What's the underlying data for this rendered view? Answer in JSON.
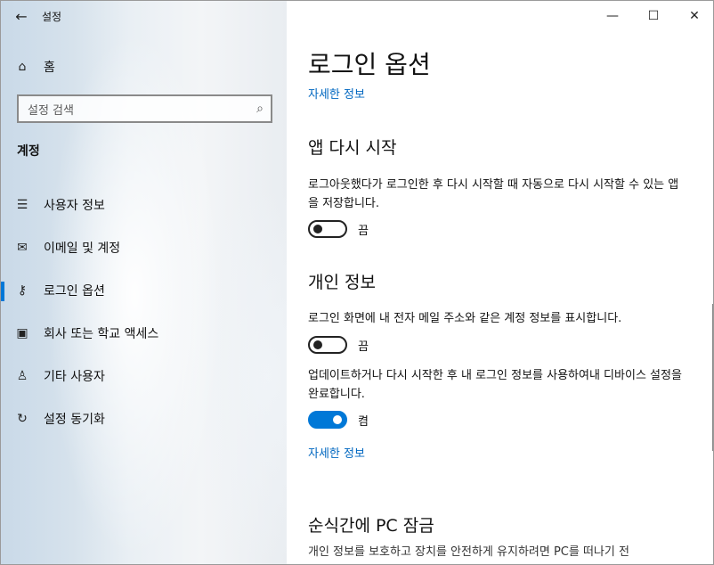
{
  "window": {
    "title": "설정",
    "back_glyph": "←",
    "controls": {
      "minimize": "—",
      "maximize": "☐",
      "close": "✕"
    }
  },
  "sidebar": {
    "home": {
      "icon": "⌂",
      "label": "홈"
    },
    "search": {
      "placeholder": "설정 검색",
      "icon": "⌕"
    },
    "section_title": "계정",
    "items": [
      {
        "icon": "☰",
        "label": "사용자 정보",
        "selected": false
      },
      {
        "icon": "✉",
        "label": "이메일 및 계정",
        "selected": false
      },
      {
        "icon": "⚷",
        "label": "로그인 옵션",
        "selected": true
      },
      {
        "icon": "▣",
        "label": "회사 또는 학교 액세스",
        "selected": false
      },
      {
        "icon": "♙",
        "label": "기타 사용자",
        "selected": false
      },
      {
        "icon": "↻",
        "label": "설정 동기화",
        "selected": false
      }
    ]
  },
  "main": {
    "page_title": "로그인 옵션",
    "top_link": "자세한 정보",
    "app_restart": {
      "heading": "앱 다시 시작",
      "desc": "로그아웃했다가 로그인한 후 다시 시작할 때 자동으로 다시 시작할 수 있는 앱을 저장합니다.",
      "toggle_state": "off",
      "toggle_label": "끔"
    },
    "privacy": {
      "heading": "개인 정보",
      "show_email_desc": "로그인 화면에 내 전자 메일 주소와 같은 계정 정보를 표시합니다.",
      "show_email_toggle_state": "off",
      "show_email_toggle_label": "끔",
      "use_signin_desc": "업데이트하거나 다시 시작한 후 내 로그인 정보를 사용하여내 디바이스 설정을 완료합니다.",
      "use_signin_toggle_state": "on",
      "use_signin_toggle_label": "켬",
      "link": "자세한 정보"
    },
    "dynamic_lock": {
      "heading": "순식간에 PC 잠금",
      "desc": "개인 정보를 보호하고 장치를 안전하게 유지하려면 PC를 떠나기 전"
    }
  },
  "colors": {
    "accent": "#0078d7",
    "link": "#0067c0"
  }
}
